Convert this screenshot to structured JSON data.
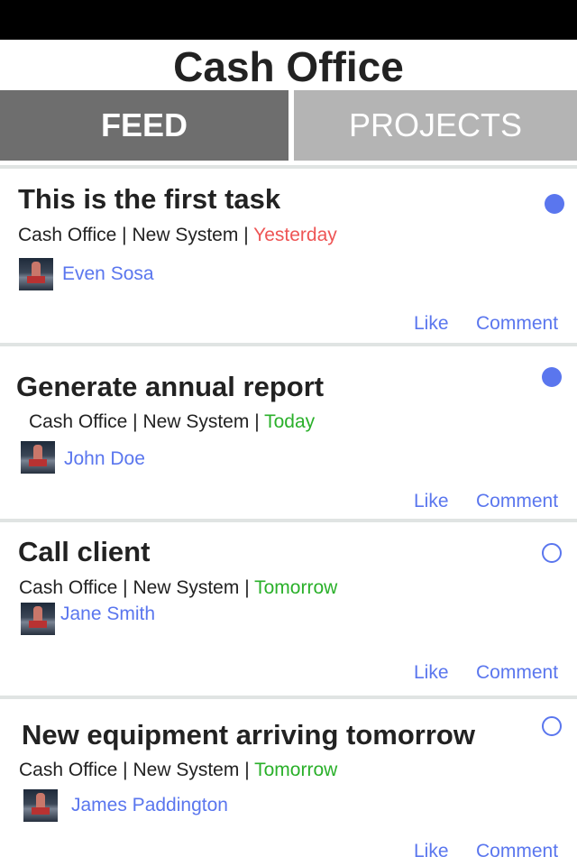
{
  "app": {
    "title": "Cash Office"
  },
  "tabs": {
    "feed": "FEED",
    "projects": "PROJECTS"
  },
  "colors": {
    "accent": "#5a76ee",
    "overdue": "#ee5555",
    "upcoming": "#2ab02a",
    "tab_active": "#6e6e6e",
    "tab_inactive": "#b4b4b4"
  },
  "feed": [
    {
      "title": "This is the first task",
      "project": "Cash Office",
      "system": "New System",
      "separator": "|",
      "due": "Yesterday",
      "assignee": "Even Sosa",
      "status": "filled",
      "actions": {
        "like": "Like",
        "comment": "Comment"
      }
    },
    {
      "title": "Generate annual report",
      "project": "Cash Office",
      "system": "New System",
      "separator": "|",
      "due": "Today",
      "assignee": "John Doe",
      "status": "filled",
      "actions": {
        "like": "Like",
        "comment": "Comment"
      }
    },
    {
      "title": "Call client",
      "project": "Cash Office",
      "system": "New System",
      "separator": "|",
      "due": "Tomorrow",
      "assignee": "Jane Smith",
      "status": "empty",
      "actions": {
        "like": "Like",
        "comment": "Comment"
      }
    },
    {
      "title": "New equipment arriving tomorrow",
      "project": "Cash Office",
      "system": "New System",
      "separator": "|",
      "due": "Tomorrow",
      "assignee": "James Paddington",
      "status": "empty",
      "actions": {
        "like": "Like",
        "comment": "Comment"
      }
    }
  ]
}
